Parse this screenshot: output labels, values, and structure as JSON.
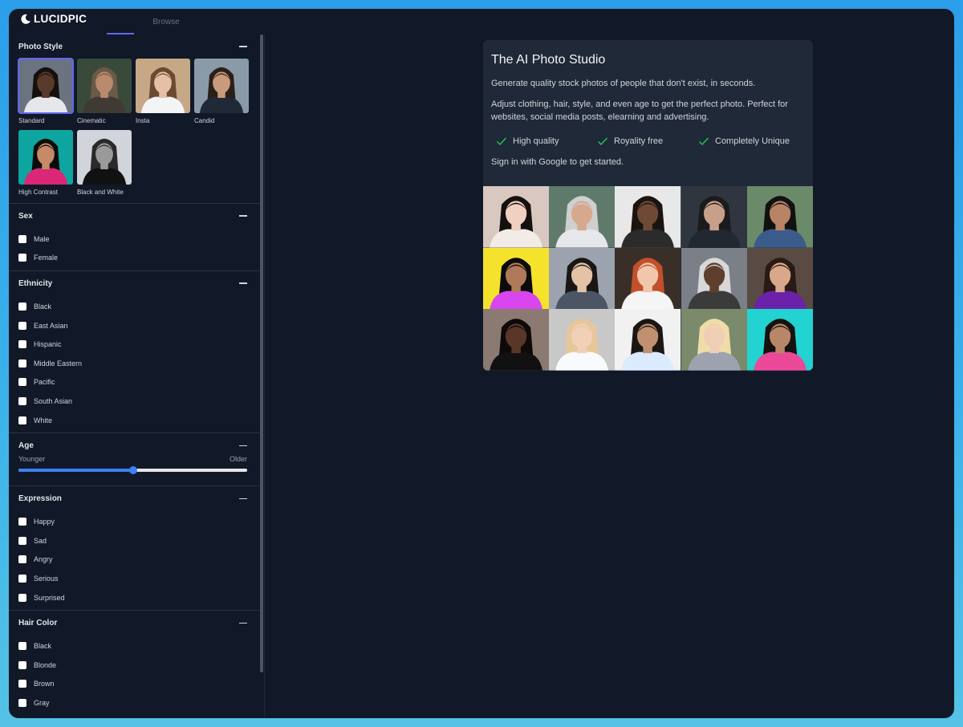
{
  "app": {
    "name": "LUCIDPIC",
    "logo_icon": "crescent-moon-icon"
  },
  "nav": {
    "tabs": [
      {
        "label": "",
        "active": true
      },
      {
        "label": "Browse",
        "active": false
      }
    ]
  },
  "sidebar": {
    "photo_style": {
      "title": "Photo Style",
      "selected": "Standard",
      "items": [
        {
          "label": "Standard",
          "bg": "#6b7280",
          "skin": "#5a3a2c",
          "hair": "#15100c",
          "shirt": "#e5e7eb"
        },
        {
          "label": "Cinematic",
          "bg": "#3a4a3a",
          "skin": "#b98a6e",
          "hair": "#6b5a48",
          "shirt": "#3f3a33"
        },
        {
          "label": "Insta",
          "bg": "#c6a887",
          "skin": "#e6c0a6",
          "hair": "#6b4a32",
          "shirt": "#f3f4f6"
        },
        {
          "label": "Candid",
          "bg": "#8a9aa8",
          "skin": "#c99a7b",
          "hair": "#2a201a",
          "shirt": "#1f2937"
        },
        {
          "label": "High Contrast",
          "bg": "#0ea5a0",
          "skin": "#c58a68",
          "hair": "#0b0b0b",
          "shirt": "#db2777"
        },
        {
          "label": "Black and White",
          "bg": "#d1d5db",
          "skin": "#9a9a9a",
          "hair": "#2a2a2a",
          "shirt": "#111111"
        }
      ]
    },
    "sex": {
      "title": "Sex",
      "options": [
        "Male",
        "Female"
      ]
    },
    "ethnicity": {
      "title": "Ethnicity",
      "options": [
        "Black",
        "East Asian",
        "Hispanic",
        "Middle Eastern",
        "Pacific",
        "South Asian",
        "White"
      ]
    },
    "age": {
      "title": "Age",
      "min_label": "Younger",
      "max_label": "Older",
      "value_fraction": 0.5
    },
    "expression": {
      "title": "Expression",
      "options": [
        "Happy",
        "Sad",
        "Angry",
        "Serious",
        "Surprised"
      ]
    },
    "hair_color": {
      "title": "Hair Color",
      "options": [
        "Black",
        "Blonde",
        "Brown",
        "Gray"
      ]
    }
  },
  "main": {
    "title": "The AI Photo Studio",
    "p1": "Generate quality stock photos of people that don't exist, in seconds.",
    "p2": "Adjust clothing, hair, style, and even age to get the perfect photo. Perfect for websites, social media posts, elearning and advertising.",
    "features": [
      "High quality",
      "Royality free",
      "Completely Unique"
    ],
    "signin": "Sign in with Google to get started.",
    "gallery": [
      {
        "bg": "#d9c8c0",
        "skin": "#f0d0c0",
        "hair": "#151010",
        "shirt": "#f3ece6"
      },
      {
        "bg": "#5f7a6a",
        "skin": "#d6a88e",
        "hair": "#cfcfcf",
        "shirt": "#e5e7eb"
      },
      {
        "bg": "#e8e8e8",
        "skin": "#6e4a36",
        "hair": "#1a1410",
        "shirt": "#2b2b2b"
      },
      {
        "bg": "#2f3640",
        "skin": "#c8a08a",
        "hair": "#1b1b1b",
        "shirt": "#222831"
      },
      {
        "bg": "#6a8a6a",
        "skin": "#b88466",
        "hair": "#111111",
        "shirt": "#3b5b8a"
      },
      {
        "bg": "#f5e22c",
        "skin": "#b07a5a",
        "hair": "#0b0b0b",
        "shirt": "#d946ef"
      },
      {
        "bg": "#9ca3af",
        "skin": "#e4c2a6",
        "hair": "#1a1614",
        "shirt": "#4b5563"
      },
      {
        "bg": "#3a2f28",
        "skin": "#f1c7ac",
        "hair": "#c2502a",
        "shirt": "#f5f5f5"
      },
      {
        "bg": "#7a7f88",
        "skin": "#5e3f2e",
        "hair": "#d8d8d8",
        "shirt": "#3b3b3b"
      },
      {
        "bg": "#5a4a44",
        "skin": "#d8a88a",
        "hair": "#2a1a14",
        "shirt": "#6b21a8"
      },
      {
        "bg": "#8a7a72",
        "skin": "#5a3628",
        "hair": "#0d0a08",
        "shirt": "#111111"
      },
      {
        "bg": "#c8c8c8",
        "skin": "#f1d0b8",
        "hair": "#e6c79a",
        "shirt": "#f9fafb"
      },
      {
        "bg": "#f1f1f1",
        "skin": "#c09070",
        "hair": "#1a1614",
        "shirt": "#dbeafe"
      },
      {
        "bg": "#7a8a6a",
        "skin": "#f0cdb5",
        "hair": "#f0dca8",
        "shirt": "#9ca3af"
      },
      {
        "bg": "#22d3d1",
        "skin": "#b8876a",
        "hair": "#161210",
        "shirt": "#ec4899"
      }
    ]
  },
  "colors": {
    "accent": "#6366f1",
    "slider": "#3b82f6",
    "check": "#22c55e",
    "window_bg": "#111827",
    "panel_bg": "#1f2937"
  }
}
